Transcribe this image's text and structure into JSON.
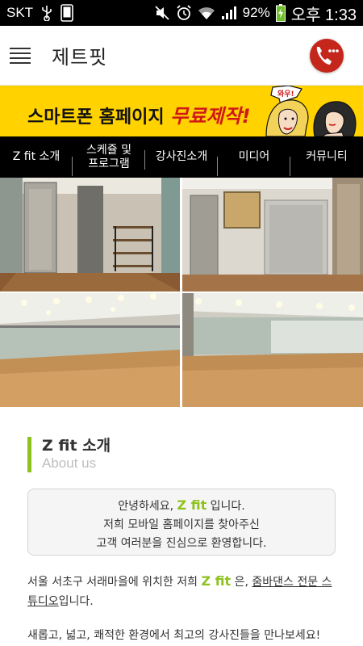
{
  "status_bar": {
    "carrier": "SKT",
    "battery": "92%",
    "time": "오후 1:33",
    "icons": [
      "usb-icon",
      "phone-icon",
      "mute-icon",
      "alarm-icon",
      "wifi-icon",
      "signal-icon",
      "battery-icon"
    ]
  },
  "header": {
    "title": "제트핏",
    "menu_icon": "hamburger-icon",
    "call_icon": "phone-call-icon",
    "call_color": "#c4261c"
  },
  "banner": {
    "text_prefix": "스마트폰 홈페이지 ",
    "text_accent": "무료제작!",
    "bubble": "와우!",
    "background": "#ffd200",
    "accent_color": "#d01818"
  },
  "nav": {
    "items": [
      {
        "line1": "Z fit 소개",
        "line2": ""
      },
      {
        "line1": "스케쥴 및",
        "line2": "프로그램"
      },
      {
        "line1": "강사진소개",
        "line2": ""
      },
      {
        "line1": "미디어",
        "line2": ""
      },
      {
        "line1": "커뮤니티",
        "line2": ""
      }
    ]
  },
  "section": {
    "title": "Z fit 소개",
    "subtitle": "About us",
    "accent_color": "#8ec21f"
  },
  "welcome": {
    "line1_pre": "안녕하세요, ",
    "line1_brand": "Z fit",
    "line1_post": " 입니다.",
    "line2": "저희 모바일 홈페이지를 찾아주신",
    "line3": "고객 여러분을 진심으로 환영합니다."
  },
  "intro": {
    "pre": "서울 서초구 서래마을에 위치한 저희 ",
    "brand": "Z fit",
    "mid": " 은, ",
    "link": "줌바댄스 전문 스튜디오",
    "post": "입니다.",
    "line2": "새롭고, 넓고, 쾌적한 환경에서 최고의 강사진들을 만나보세요!"
  }
}
